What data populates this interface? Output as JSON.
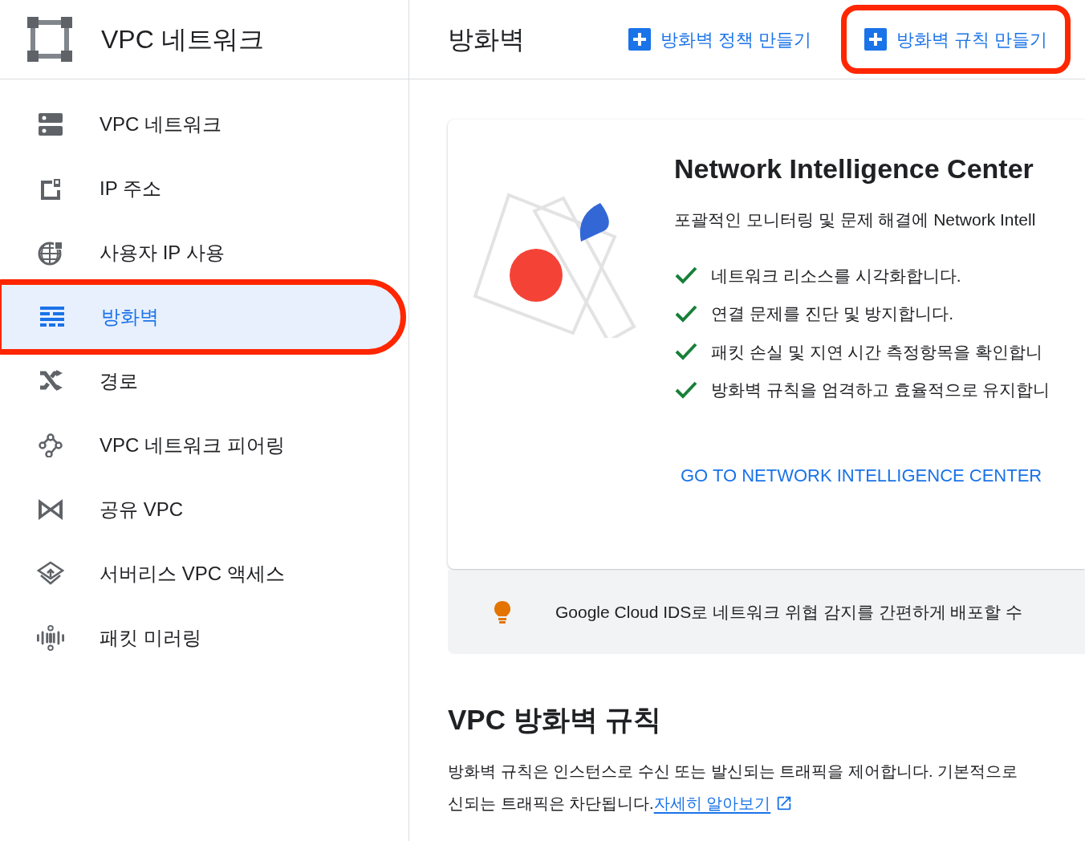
{
  "app_title": "VPC 네트워크",
  "page_title": "방화벽",
  "actions": [
    {
      "label": "방화벽 정책 만들기",
      "highlighted": false
    },
    {
      "label": "방화벽 규칙 만들기",
      "highlighted": true
    }
  ],
  "sidebar": {
    "items": [
      {
        "kind": "network",
        "label": "VPC 네트워크",
        "selected": false,
        "highlighted": false
      },
      {
        "kind": "ip",
        "label": "IP 주소",
        "selected": false,
        "highlighted": false
      },
      {
        "kind": "globe",
        "label": "사용자 IP 사용",
        "selected": false,
        "highlighted": false
      },
      {
        "kind": "firewall",
        "label": "방화벽",
        "selected": true,
        "highlighted": true
      },
      {
        "kind": "routes",
        "label": "경로",
        "selected": false,
        "highlighted": false
      },
      {
        "kind": "peering",
        "label": "VPC 네트워크 피어링",
        "selected": false,
        "highlighted": false
      },
      {
        "kind": "shared",
        "label": "공유 VPC",
        "selected": false,
        "highlighted": false
      },
      {
        "kind": "serverless",
        "label": "서버리스 VPC 액세스",
        "selected": false,
        "highlighted": false
      },
      {
        "kind": "mirroring",
        "label": "패킷 미러링",
        "selected": false,
        "highlighted": false
      }
    ]
  },
  "promo": {
    "title": "Network Intelligence Center",
    "subtitle": "포괄적인 모니터링 및 문제 해결에 Network Intell",
    "features": [
      "네트워크 리소스를 시각화합니다.",
      "연결 문제를 진단 및 방지합니다.",
      "패킷 손실 및 지연 시간 측정항목을 확인합니",
      "방화벽 규칙을 엄격하고 효율적으로 유지합니"
    ],
    "link": "GO TO NETWORK INTELLIGENCE CENTER"
  },
  "tip": "Google Cloud IDS로 네트워크 위협 감지를 간편하게 배포할 수",
  "section": {
    "title": "VPC 방화벽 규칙",
    "line_1": "방화벽 규칙은 인스턴스로 수신 또는 발신되는 트래픽을 제어합니다. 기본적으로",
    "line_2": "신되는 트래픽은 차단됩니다.",
    "link": "자세히 알아보기"
  }
}
